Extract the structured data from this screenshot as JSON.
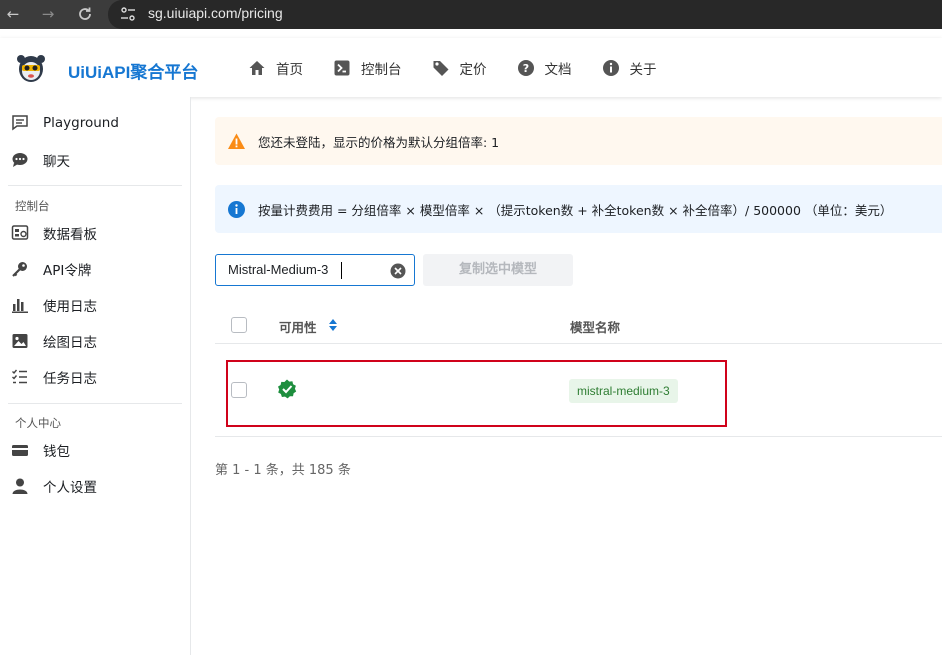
{
  "browser": {
    "url": "sg.uiuiapi.com/pricing"
  },
  "header": {
    "brand": "UiUiAPI聚合平台",
    "nav": [
      {
        "label": "首页",
        "icon": "home-icon"
      },
      {
        "label": "控制台",
        "icon": "terminal-icon"
      },
      {
        "label": "定价",
        "icon": "tag-icon"
      },
      {
        "label": "文档",
        "icon": "help-icon"
      },
      {
        "label": "关于",
        "icon": "info-icon"
      }
    ]
  },
  "sidebar": {
    "top_items": [
      {
        "label": "Playground",
        "icon": "chat-square-icon"
      },
      {
        "label": "聊天",
        "icon": "chat-bubble-icon"
      }
    ],
    "console_group": "控制台",
    "console_items": [
      {
        "label": "数据看板",
        "icon": "dashboard-icon"
      },
      {
        "label": "API令牌",
        "icon": "key-icon"
      },
      {
        "label": "使用日志",
        "icon": "bar-chart-icon"
      },
      {
        "label": "绘图日志",
        "icon": "image-icon"
      },
      {
        "label": "任务日志",
        "icon": "task-list-icon"
      }
    ],
    "personal_group": "个人中心",
    "personal_items": [
      {
        "label": "钱包",
        "icon": "wallet-icon"
      },
      {
        "label": "个人设置",
        "icon": "user-icon"
      }
    ]
  },
  "main": {
    "warning_text": "您还未登陆，显示的价格为默认分组倍率: 1",
    "info_text": "按量计费费用 = 分组倍率 × 模型倍率 × （提示token数 + 补全token数 × 补全倍率）/ 500000 （单位：美元）",
    "search_value": "Mistral-Medium-3",
    "copy_button": "复制选中模型",
    "columns": {
      "availability": "可用性",
      "model_name": "模型名称"
    },
    "rows": [
      {
        "model": "mistral-medium-3",
        "available": true
      }
    ],
    "pagination": "第 1 - 1 条，共 185 条"
  },
  "colors": {
    "brand": "#1677d2",
    "warning": "#fa8c16",
    "success": "#1e8e3e",
    "highlight": "#d0021b"
  }
}
